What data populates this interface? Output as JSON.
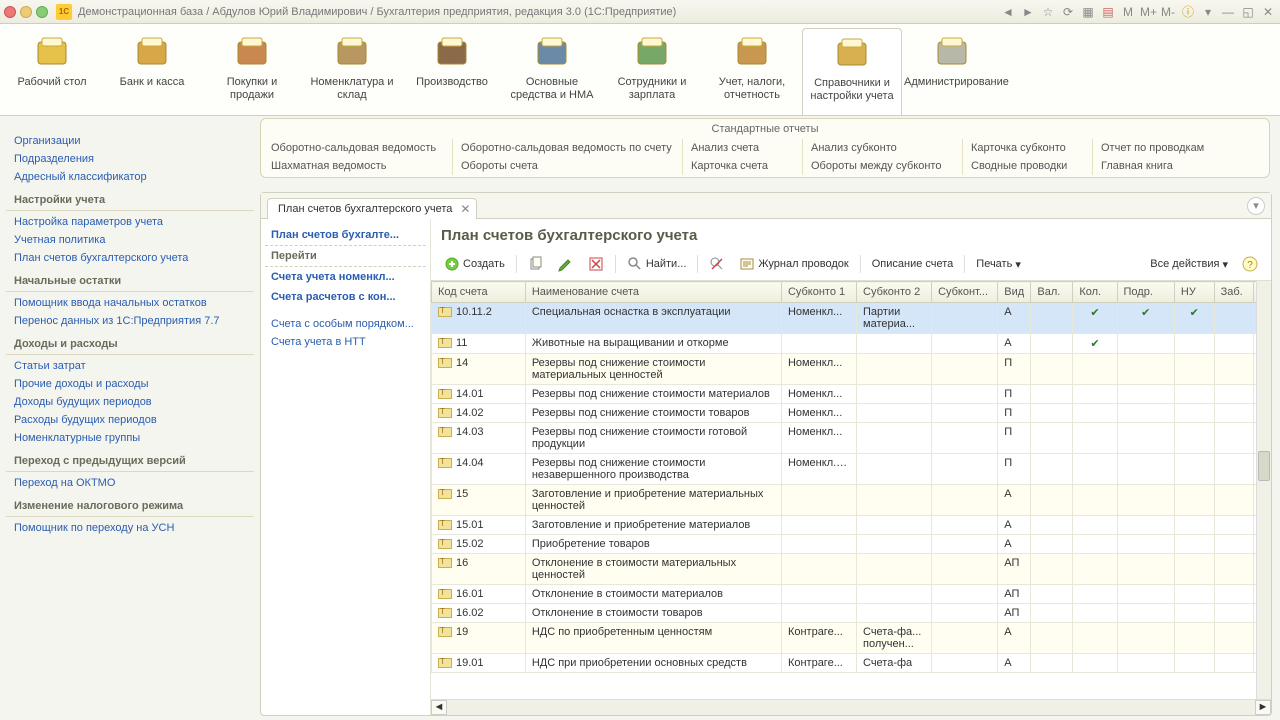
{
  "titlebar": {
    "text": "Демонстрационная база / Абдулов Юрий Владимирович / Бухгалтерия предприятия, редакция 3.0  (1С:Предприятие)",
    "win_labels": [
      "M",
      "M+",
      "M-"
    ]
  },
  "sections": [
    {
      "label": "Рабочий стол"
    },
    {
      "label": "Банк и касса"
    },
    {
      "label": "Покупки и продажи"
    },
    {
      "label": "Номенклатура и склад"
    },
    {
      "label": "Производство"
    },
    {
      "label": "Основные средства и НМА"
    },
    {
      "label": "Сотрудники и зарплата"
    },
    {
      "label": "Учет, налоги, отчетность"
    },
    {
      "label": "Справочники и настройки учета"
    },
    {
      "label": "Администрирование"
    }
  ],
  "reports": {
    "title": "Стандартные отчеты",
    "cells": [
      [
        "Оборотно-сальдовая ведомость",
        "Оборотно-сальдовая ведомость по счету",
        "Анализ счета",
        "Анализ субконто",
        "Карточка субконто",
        "Отчет по проводкам"
      ],
      [
        "Шахматная ведомость",
        "Обороты счета",
        "Карточка счета",
        "Обороты между субконто",
        "Сводные проводки",
        "Главная книга"
      ]
    ]
  },
  "leftnav": [
    {
      "type": "link",
      "text": "Организации"
    },
    {
      "type": "link",
      "text": "Подразделения"
    },
    {
      "type": "link",
      "text": "Адресный классификатор"
    },
    {
      "type": "head",
      "text": "Настройки учета"
    },
    {
      "type": "link",
      "text": "Настройка параметров учета"
    },
    {
      "type": "link",
      "text": "Учетная политика"
    },
    {
      "type": "link",
      "text": "План счетов бухгалтерского учета"
    },
    {
      "type": "head",
      "text": "Начальные остатки"
    },
    {
      "type": "link",
      "text": "Помощник ввода начальных остатков"
    },
    {
      "type": "link",
      "text": "Перенос данных из 1С:Предприятия 7.7"
    },
    {
      "type": "head",
      "text": "Доходы и расходы"
    },
    {
      "type": "link",
      "text": "Статьи затрат"
    },
    {
      "type": "link",
      "text": "Прочие доходы и расходы"
    },
    {
      "type": "link",
      "text": "Доходы будущих периодов"
    },
    {
      "type": "link",
      "text": "Расходы будущих периодов"
    },
    {
      "type": "link",
      "text": "Номенклатурные группы"
    },
    {
      "type": "head",
      "text": "Переход с предыдущих версий"
    },
    {
      "type": "link",
      "text": "Переход на ОКТМО"
    },
    {
      "type": "head",
      "text": "Изменение налогового режима"
    },
    {
      "type": "link",
      "text": "Помощник по переходу на УСН"
    }
  ],
  "tab": {
    "label": "План счетов бухгалтерского учета"
  },
  "inner_nav": {
    "head": "План счетов бухгалте...",
    "go": "Перейти",
    "links": [
      "Счета учета номенкл...",
      "Счета расчетов с кон..."
    ],
    "subs": [
      "Счета с особым порядком...",
      "Счета учета в НТТ"
    ]
  },
  "page_title": "План счетов бухгалтерского учета",
  "toolbar": {
    "create": "Создать",
    "find": "Найти...",
    "journal": "Журнал проводок",
    "desc": "Описание счета",
    "print": "Печать",
    "all": "Все действия"
  },
  "columns": [
    "Код счета",
    "Наименование счета",
    "Субконто 1",
    "Субконто 2",
    "Субконт...",
    "Вид",
    "Вал.",
    "Кол.",
    "Подр.",
    "НУ",
    "Заб."
  ],
  "rows": [
    {
      "code": "10.11.2",
      "name": "Специальная оснастка в эксплуатации",
      "s1": "Номенкл...",
      "s2": "Партии материа...",
      "vid": "А",
      "kol": "✔",
      "podr": "✔",
      "nu": "✔",
      "sel": true
    },
    {
      "code": "11",
      "name": "Животные на выращивании и откорме",
      "vid": "А",
      "kol": "✔"
    },
    {
      "code": "14",
      "name": "Резервы под снижение стоимости материальных ценностей",
      "s1": "Номенкл...",
      "vid": "П",
      "alt": true,
      "wrap": true
    },
    {
      "code": "14.01",
      "name": "Резервы под снижение стоимости материалов",
      "s1": "Номенкл...",
      "vid": "П",
      "wrap": true
    },
    {
      "code": "14.02",
      "name": "Резервы под снижение стоимости товаров",
      "s1": "Номенкл...",
      "vid": "П"
    },
    {
      "code": "14.03",
      "name": "Резервы под снижение стоимости готовой продукции",
      "s1": "Номенкл...",
      "vid": "П",
      "wrap": true
    },
    {
      "code": "14.04",
      "name": "Резервы под снижение стоимости незавершенного производства",
      "s1": "Номенкл... группы",
      "vid": "П",
      "wrap": true
    },
    {
      "code": "15",
      "name": "Заготовление и приобретение материальных ценностей",
      "vid": "А",
      "alt": true,
      "wrap": true
    },
    {
      "code": "15.01",
      "name": "Заготовление и приобретение материалов",
      "vid": "А"
    },
    {
      "code": "15.02",
      "name": "Приобретение товаров",
      "vid": "А"
    },
    {
      "code": "16",
      "name": "Отклонение в стоимости материальных ценностей",
      "vid": "АП",
      "alt": true,
      "wrap": true
    },
    {
      "code": "16.01",
      "name": "Отклонение в стоимости материалов",
      "vid": "АП"
    },
    {
      "code": "16.02",
      "name": "Отклонение в стоимости товаров",
      "vid": "АП"
    },
    {
      "code": "19",
      "name": "НДС по приобретенным ценностям",
      "s1": "Контраге...",
      "s2": "Счета-фа... получен...",
      "vid": "А",
      "alt": true
    },
    {
      "code": "19.01",
      "name": "НДС при приобретении основных средств",
      "s1": "Контраге...",
      "s2": "Счета-фа",
      "vid": "А"
    }
  ]
}
